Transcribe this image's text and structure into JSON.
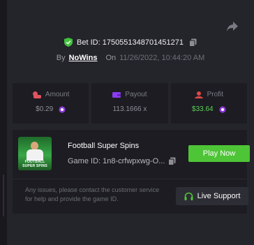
{
  "bet": {
    "id_text": "Bet ID: 1750551348701451271",
    "by_label": "By",
    "username": "NoWins",
    "on_label": "On",
    "datetime": "11/26/2022, 10:44:20 AM"
  },
  "stats": [
    {
      "label": "Amount",
      "value": "$0.29",
      "icon": "coins-icon",
      "color": "#e0525f"
    },
    {
      "label": "Payout",
      "value": "113.1666 x",
      "icon": "payout-icon",
      "color": "#8a3df0"
    },
    {
      "label": "Profit",
      "value": "$33.64",
      "icon": "profit-icon",
      "color": "#e04848",
      "value_color": "#5ed35a"
    }
  ],
  "game": {
    "thumbnail_text": "FOOTBALL SUPER SPINS",
    "name": "Football Super Spins",
    "id_text": "Game ID: 1n8-crfwpxwg-O...",
    "play_label": "Play Now",
    "play_color": "#4ec536"
  },
  "support": {
    "help_text": "Any issues, please contact the customer service for help and provide the game ID.",
    "button_label": "Live Support",
    "icon": "headset-icon"
  },
  "colors": {
    "background": "#24242b",
    "card": "#1c1c22",
    "accent_green": "#4ec536",
    "shield_green": "#41c23c"
  }
}
